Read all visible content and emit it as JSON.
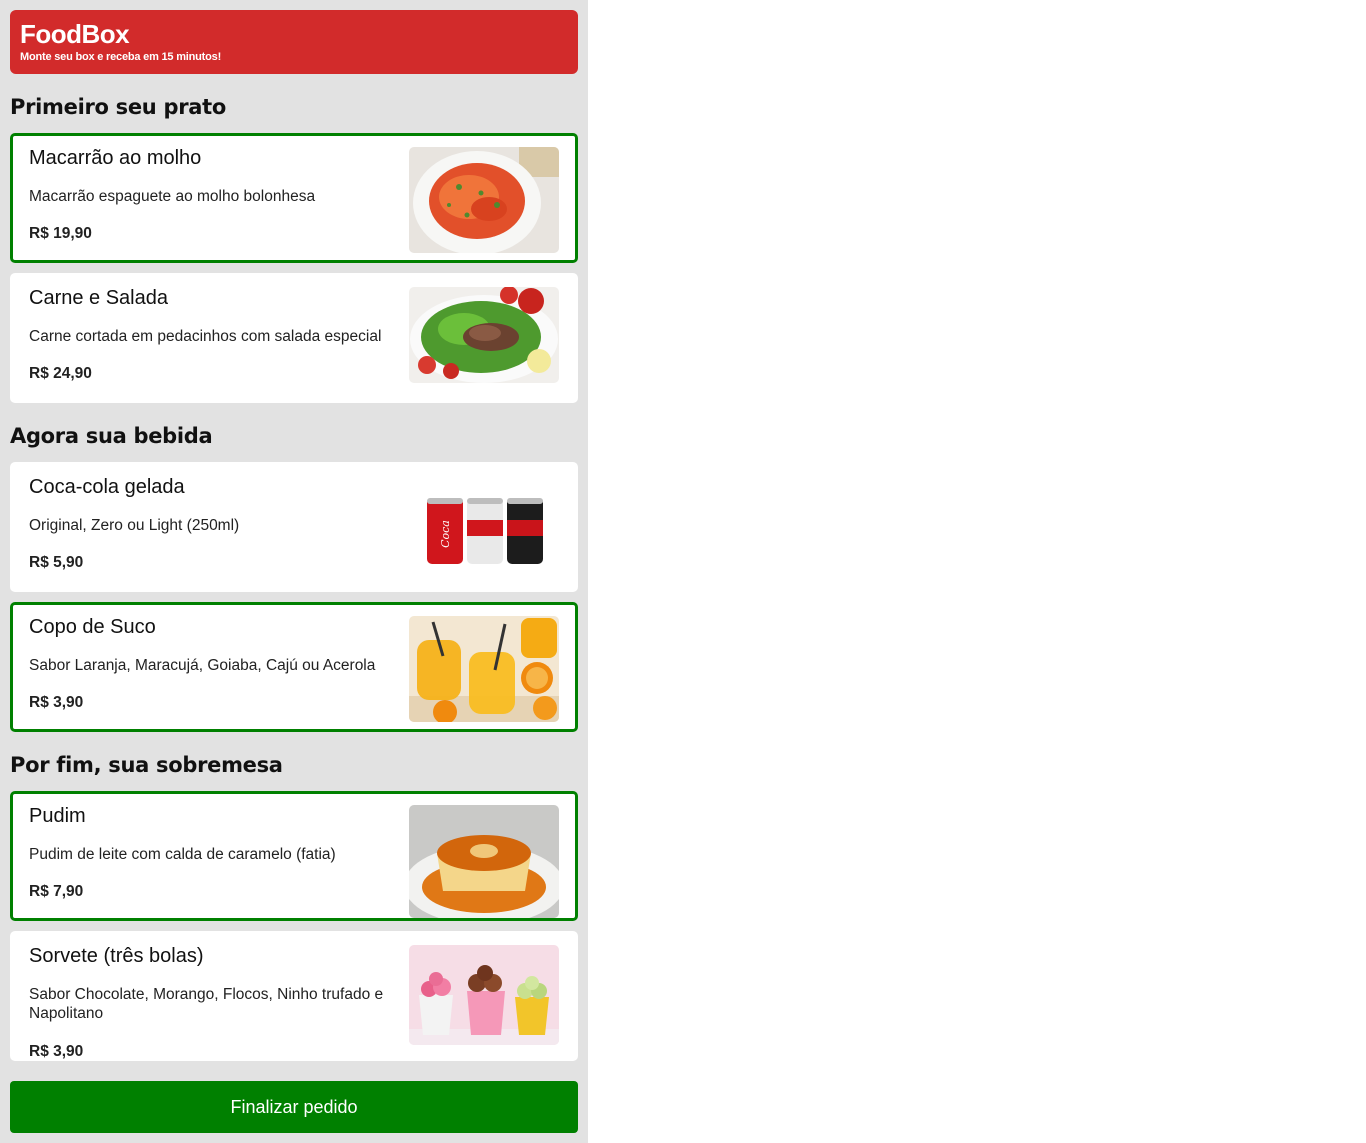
{
  "header": {
    "title": "FoodBox",
    "subtitle": "Monte seu box e receba em 15 minutos!"
  },
  "sections": [
    {
      "title": "Primeiro seu prato",
      "items": [
        {
          "name": "Macarrão ao molho",
          "description": "Macarrão espaguete ao molho bolonhesa",
          "price": "R$ 19,90",
          "selected": true,
          "image": "pasta-image"
        },
        {
          "name": "Carne e Salada",
          "description": "Carne cortada em pedacinhos com salada especial",
          "price": "R$ 24,90",
          "selected": false,
          "image": "meat-salad-image"
        }
      ]
    },
    {
      "title": "Agora sua bebida",
      "items": [
        {
          "name": "Coca-cola gelada",
          "description": "Original, Zero ou Light (250ml)",
          "price": "R$ 5,90",
          "selected": false,
          "image": "cola-cans-image"
        },
        {
          "name": "Copo de Suco",
          "description": "Sabor Laranja, Maracujá, Goiaba, Cajú ou Acerola",
          "price": "R$ 3,90",
          "selected": true,
          "image": "orange-juice-image"
        }
      ]
    },
    {
      "title": "Por fim, sua sobremesa",
      "items": [
        {
          "name": "Pudim",
          "description": "Pudim de leite com calda de caramelo (fatia)",
          "price": "R$ 7,90",
          "selected": true,
          "image": "pudding-image"
        },
        {
          "name": "Sorvete (três bolas)",
          "description": "Sabor Chocolate, Morango, Flocos, Ninho trufado e Napolitano",
          "price": "R$ 3,90",
          "selected": false,
          "image": "ice-cream-image"
        }
      ]
    }
  ],
  "finish_button": {
    "label": "Finalizar pedido"
  },
  "colors": {
    "header": "#d22b2b",
    "selected_border": "#008000",
    "finish_button": "#008000",
    "background": "#e2e2e2"
  }
}
